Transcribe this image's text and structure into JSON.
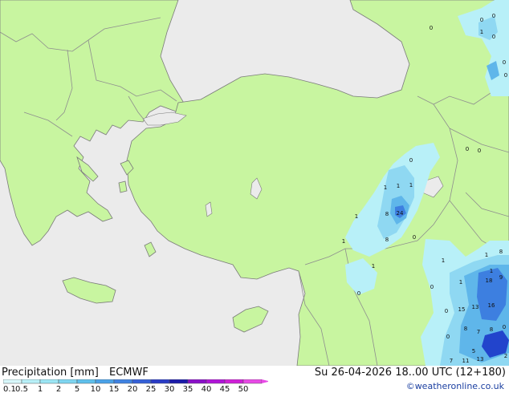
{
  "map": {
    "colors": {
      "sea": "#ebebeb",
      "land": "#c8f5a0",
      "border": "#8e8e8e",
      "coast": "#7a7a7a",
      "precip_1": "#b8f0f8",
      "precip_2": "#8fd8f2",
      "precip_3": "#5fb6ea",
      "precip_4": "#3d7fe0",
      "precip_5": "#2244cc"
    },
    "values": [
      {
        "text": "0"
      },
      {
        "text": "0"
      },
      {
        "text": "0"
      },
      {
        "text": "1"
      },
      {
        "text": "0"
      },
      {
        "text": "0"
      },
      {
        "text": "0"
      },
      {
        "text": "0"
      },
      {
        "text": "0"
      },
      {
        "text": "0"
      },
      {
        "text": "1"
      },
      {
        "text": "1"
      },
      {
        "text": "1"
      },
      {
        "text": "8"
      },
      {
        "text": "24"
      },
      {
        "text": "1"
      },
      {
        "text": "8"
      },
      {
        "text": "0"
      },
      {
        "text": "1"
      },
      {
        "text": "1"
      },
      {
        "text": "0"
      },
      {
        "text": "1"
      },
      {
        "text": "0"
      },
      {
        "text": "1"
      },
      {
        "text": "8"
      },
      {
        "text": "1"
      },
      {
        "text": "1"
      },
      {
        "text": "18"
      },
      {
        "text": "9"
      },
      {
        "text": "0"
      },
      {
        "text": "15"
      },
      {
        "text": "13"
      },
      {
        "text": "16"
      },
      {
        "text": "8"
      },
      {
        "text": "7"
      },
      {
        "text": "8"
      },
      {
        "text": "5"
      },
      {
        "text": "0"
      },
      {
        "text": "11"
      },
      {
        "text": "13"
      },
      {
        "text": "7"
      },
      {
        "text": "2"
      },
      {
        "text": "0"
      }
    ]
  },
  "footer": {
    "title": "Precipitation [mm]",
    "model": "ECMWF",
    "valid": "Su 26-04-2026 18..00 UTC (12+180)",
    "credit": "©weatheronline.co.uk"
  },
  "legend": {
    "labels": [
      "0.1",
      "0.5",
      "1",
      "2",
      "5",
      "10",
      "15",
      "20",
      "25",
      "30",
      "35",
      "40",
      "45",
      "50"
    ],
    "colors": [
      "#d8f8fb",
      "#b8f0f8",
      "#9ce6f5",
      "#7fd6f1",
      "#5fc0ec",
      "#4aa2e8",
      "#3f82e2",
      "#3560d8",
      "#2a3cc6",
      "#1c1caa",
      "#8a10c8",
      "#b014d8",
      "#d020d8",
      "#e84ae6"
    ]
  }
}
